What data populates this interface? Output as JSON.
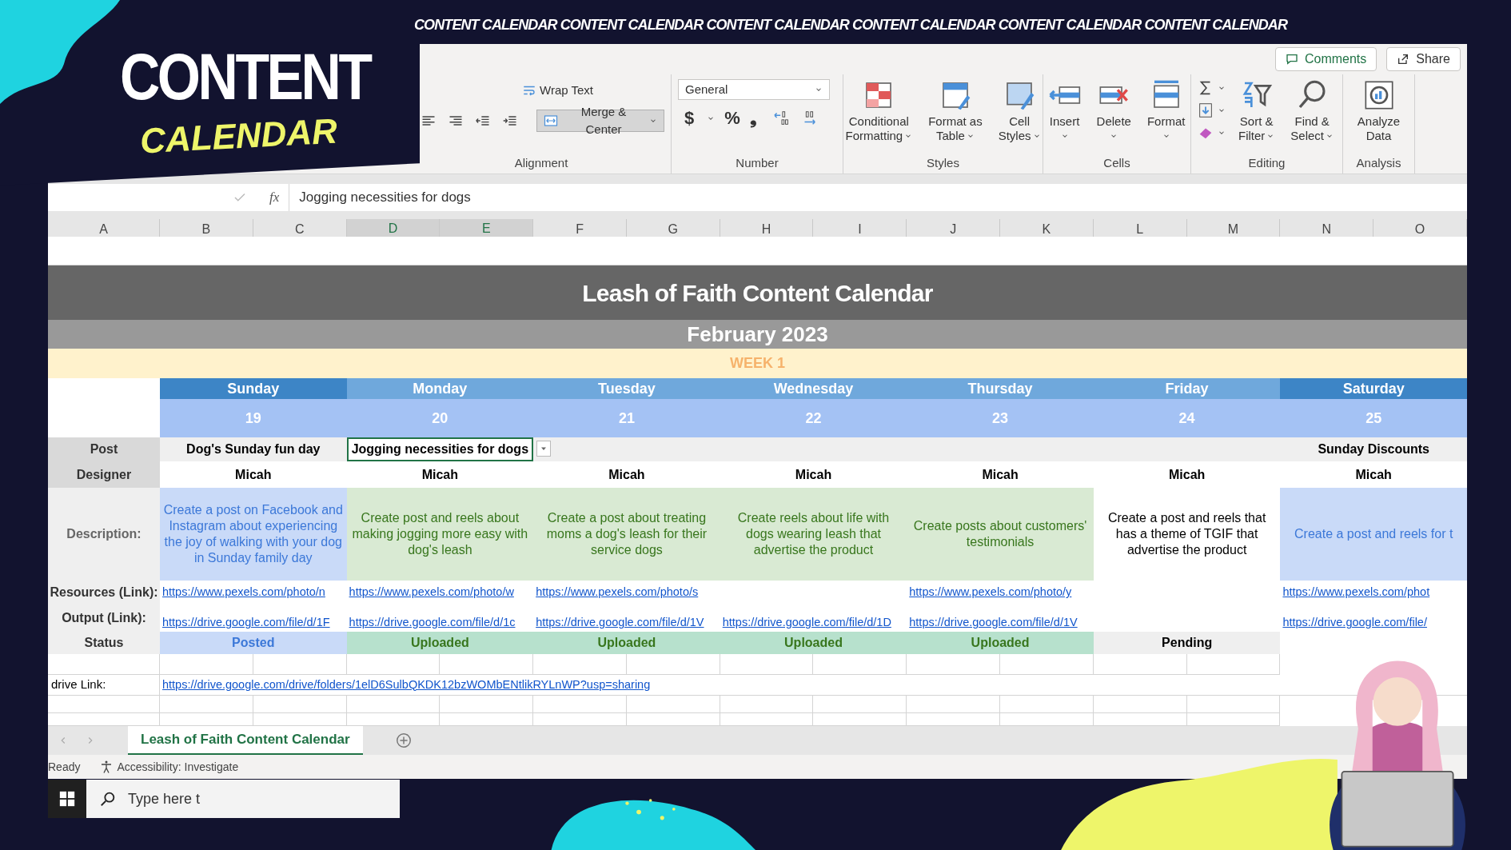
{
  "logo": {
    "top": "CONTENT",
    "bottom": "CALENDAR"
  },
  "banner": "CONTENT CALENDAR CONTENT CALENDAR CONTENT CALENDAR CONTENT CALENDAR CONTENT CALENDAR CONTENT CALENDAR",
  "ribbon": {
    "buttons": [
      {
        "kind": "comments",
        "label": "Comments"
      },
      {
        "kind": "share",
        "label": "Share"
      }
    ],
    "groups": [
      {
        "label": "Alignment",
        "items": [
          {
            "kind": "align",
            "wrap": "Wrap Text",
            "merge": "Merge & Center"
          }
        ]
      },
      {
        "label": "Number",
        "items": [
          {
            "kind": "number",
            "format": "General",
            "symbols": [
              "$",
              "%",
              "❟"
            ]
          }
        ]
      },
      {
        "label": "Styles",
        "items": [
          {
            "kind": "large",
            "lines": [
              "Conditional",
              "Formatting"
            ],
            "caret": true
          },
          {
            "kind": "large",
            "lines": [
              "Format as",
              "Table"
            ],
            "caret": true
          },
          {
            "kind": "large",
            "lines": [
              "Cell",
              "Styles"
            ],
            "caret": true
          }
        ]
      },
      {
        "label": "Cells",
        "items": [
          {
            "kind": "large",
            "lines": [
              "Insert"
            ],
            "caret": true
          },
          {
            "kind": "large",
            "lines": [
              "Delete"
            ],
            "caret": true
          },
          {
            "kind": "large",
            "lines": [
              "Format"
            ],
            "caret": true
          }
        ]
      },
      {
        "label": "Editing",
        "items": [
          {
            "kind": "tools"
          },
          {
            "kind": "large",
            "lines": [
              "Sort &",
              "Filter"
            ],
            "caret": true
          },
          {
            "kind": "large",
            "lines": [
              "Find &",
              "Select"
            ],
            "caret": true
          }
        ]
      },
      {
        "label": "Analysis",
        "items": [
          {
            "kind": "large",
            "lines": [
              "Analyze",
              "Data"
            ],
            "caret": false
          }
        ]
      }
    ]
  },
  "formula_bar": {
    "function_label": "fx",
    "value": "Jogging necessities for dogs"
  },
  "columns": [
    {
      "label": "A",
      "selected": false
    },
    {
      "label": "B",
      "selected": false
    },
    {
      "label": "C",
      "selected": false
    },
    {
      "label": "D",
      "selected": true
    },
    {
      "label": "E",
      "selected": true
    },
    {
      "label": "F",
      "selected": false
    },
    {
      "label": "G",
      "selected": false
    },
    {
      "label": "H",
      "selected": false
    },
    {
      "label": "I",
      "selected": false
    },
    {
      "label": "J",
      "selected": false
    },
    {
      "label": "K",
      "selected": false
    },
    {
      "label": "L",
      "selected": false
    },
    {
      "label": "M",
      "selected": false
    },
    {
      "label": "N",
      "selected": false
    },
    {
      "label": "O",
      "selected": false
    }
  ],
  "sheet": {
    "title": "Leash of Faith Content Calendar",
    "month": "February 2023",
    "week": "WEEK 1",
    "labels": [
      "Post",
      "Designer",
      "Description:",
      "Resources (Link):",
      "Output (Link):",
      "Status"
    ],
    "days": [
      {
        "name": "Sunday",
        "date": "19",
        "weekend": true,
        "post": {
          "text": "Dog's Sunday fun day",
          "selected": false
        },
        "designer": "Micah",
        "description": {
          "text": "Create a post on Facebook and Instagram about experiencing the joy of walking with your dog in Sunday family day",
          "kind": "blue"
        },
        "resource": "https://www.pexels.com/photo/n",
        "output": "https://drive.google.com/file/d/1F",
        "status": {
          "text": "Posted",
          "kind": "posted"
        }
      },
      {
        "name": "Monday",
        "date": "20",
        "weekend": false,
        "post": {
          "text": "Jogging necessities for dogs",
          "selected": true
        },
        "designer": "Micah",
        "description": {
          "text": "Create post and reels about making jogging more easy with dog's leash",
          "kind": "green"
        },
        "resource": "https://www.pexels.com/photo/w",
        "output": "https://drive.google.com/file/d/1c",
        "status": {
          "text": "Uploaded",
          "kind": "uploaded"
        }
      },
      {
        "name": "Tuesday",
        "date": "21",
        "weekend": false,
        "designer": "Micah",
        "description": {
          "text": "Create a post about treating moms a dog's leash for their service dogs",
          "kind": "green"
        },
        "resource": "https://www.pexels.com/photo/s",
        "output": "https://drive.google.com/file/d/1V",
        "status": {
          "text": "Uploaded",
          "kind": "uploaded"
        }
      },
      {
        "name": "Wednesday",
        "date": "22",
        "weekend": false,
        "designer": "Micah",
        "description": {
          "text": "Create reels about life with dogs wearing leash that advertise the product",
          "kind": "green"
        },
        "output": "https://drive.google.com/file/d/1D",
        "status": {
          "text": "Uploaded",
          "kind": "uploaded"
        }
      },
      {
        "name": "Thursday",
        "date": "23",
        "weekend": false,
        "designer": "Micah",
        "description": {
          "text": "Create posts about customers' testimonials",
          "kind": "green"
        },
        "resource": "https://www.pexels.com/photo/y",
        "output": "https://drive.google.com/file/d/1V",
        "status": {
          "text": "Uploaded",
          "kind": "uploaded"
        }
      },
      {
        "name": "Friday",
        "date": "24",
        "weekend": false,
        "designer": "Micah",
        "description": {
          "text": "Create a post and reels that has a theme of TGIF that advertise the product",
          "kind": "plain"
        },
        "status": {
          "text": "Pending",
          "kind": "pending"
        }
      },
      {
        "name": "Saturday",
        "date": "25",
        "weekend": true,
        "post": {
          "text": "Sunday Discounts",
          "selected": false
        },
        "designer": "Micah",
        "description": {
          "text": "Create a post and reels for t",
          "kind": "blue"
        },
        "resource": "https://www.pexels.com/phot",
        "output": "https://drive.google.com/file/"
      }
    ],
    "drive": {
      "label": "drive Link:",
      "link": "https://drive.google.com/drive/folders/1elD6SulbQKDK12bzWOMbENtlikRYLnWP?usp=sharing"
    }
  },
  "sheet_tabs": [
    {
      "label": "Leash of Faith Content Calendar",
      "selected": true
    }
  ],
  "status_bar": {
    "ready": "Ready",
    "accessibility": "Accessibility: Investigate"
  },
  "taskbar": {
    "search_placeholder": "Type here t"
  }
}
